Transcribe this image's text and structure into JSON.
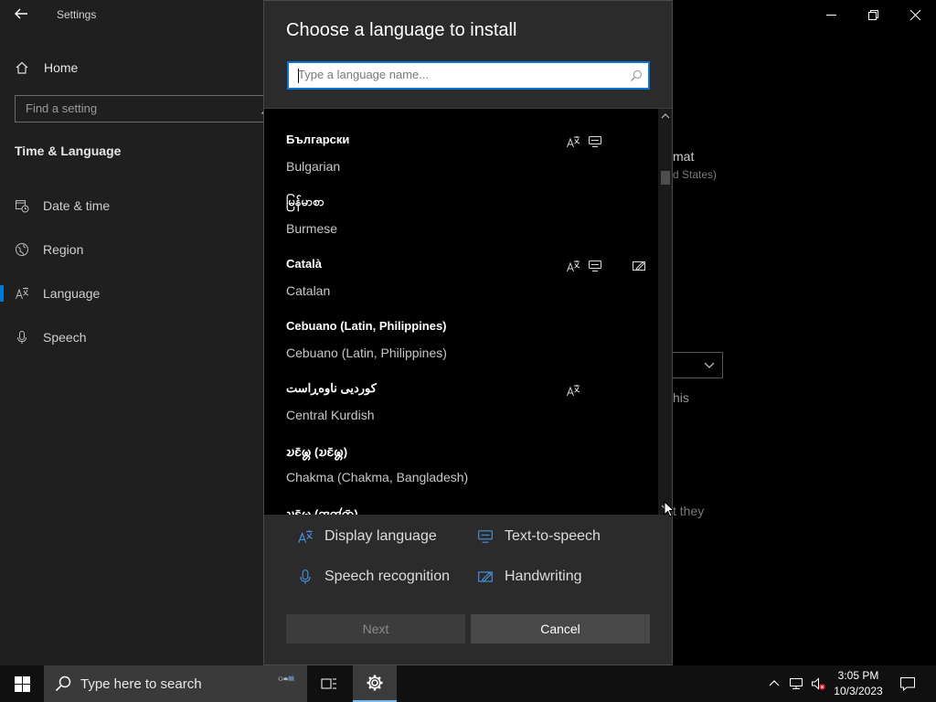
{
  "window": {
    "app_title": "Settings",
    "controls": [
      "minimize-icon",
      "restore-icon",
      "close-icon"
    ]
  },
  "sidebar": {
    "home_label": "Home",
    "search_placeholder": "Find a setting",
    "section_title": "Time & Language",
    "items": [
      {
        "label": "Date & time",
        "icon": "calendar-clock-icon"
      },
      {
        "label": "Region",
        "icon": "globe-icon"
      },
      {
        "label": "Language",
        "icon": "language-icon",
        "active": true
      },
      {
        "label": "Speech",
        "icon": "microphone-icon"
      }
    ]
  },
  "background_fragments": {
    "format": "mat",
    "region_value": "d States)",
    "this": "his",
    "they": "t they"
  },
  "dialog": {
    "title": "Choose a language to install",
    "search_placeholder": "Type a language name...",
    "languages": [
      {
        "native": "Български",
        "english": "Bulgarian",
        "features": [
          "display",
          "tts"
        ]
      },
      {
        "native": "မြန်မာစာ",
        "english": "Burmese",
        "features": []
      },
      {
        "native": "Català",
        "english": "Catalan",
        "features": [
          "display",
          "tts",
          "handwriting"
        ]
      },
      {
        "native": "Cebuano (Latin, Philippines)",
        "english": "Cebuano (Latin, Philippines)",
        "features": []
      },
      {
        "native": "کوردیی ناوەڕاست",
        "english": "Central Kurdish",
        "features": [
          "display"
        ]
      },
      {
        "native": "𑄌𑄋𑄴𑄟𑄳𑄦 (𑄌𑄋𑄴𑄟𑄳𑄦)",
        "english": "Chakma (Chakma, Bangladesh)",
        "features": []
      },
      {
        "native": "𑄌𑄋𑄴𑄟𑄳𑄦 (𑄞𑄢𑄧𑄖𑄴)",
        "english": "",
        "features": []
      }
    ],
    "legend": {
      "display": "Display language",
      "tts": "Text-to-speech",
      "speech": "Speech recognition",
      "handwriting": "Handwriting"
    },
    "buttons": {
      "next": "Next",
      "cancel": "Cancel"
    }
  },
  "taskbar": {
    "search_placeholder": "Type here to search",
    "time": "3:05 PM",
    "date": "10/3/2023"
  },
  "colors": {
    "accent": "#0078d7",
    "icon_blue": "#4a90e2",
    "dialog_bg": "#2b2b2b",
    "list_bg": "#000000"
  }
}
